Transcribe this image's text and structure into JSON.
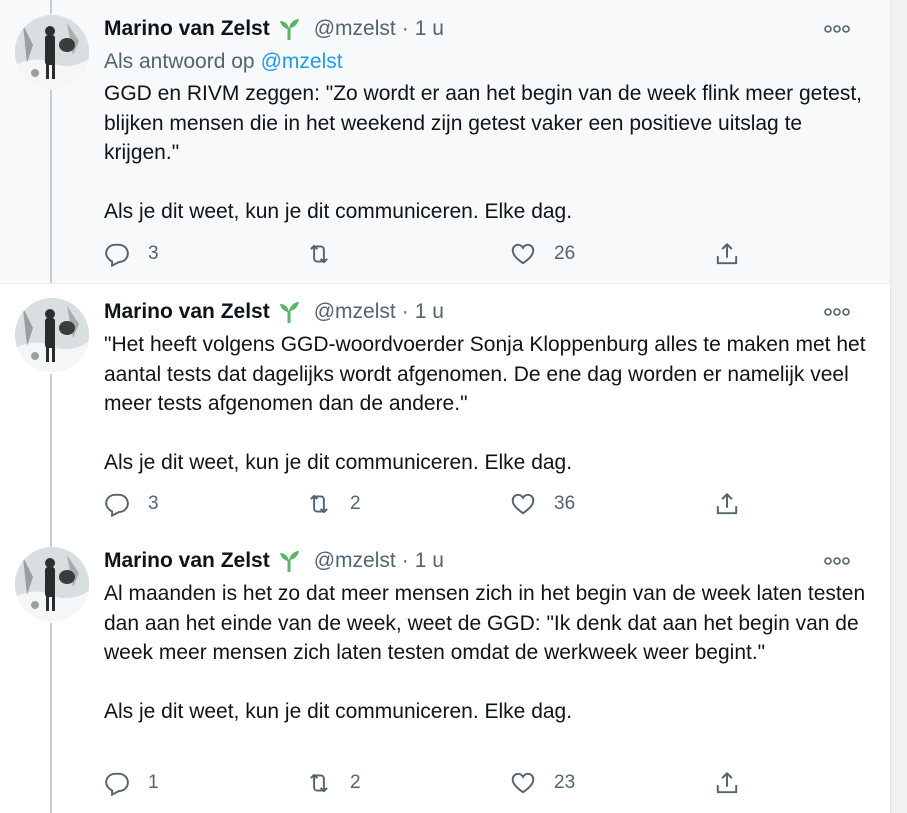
{
  "tweets": [
    {
      "author_name": "Marino van Zelst",
      "handle": "@mzelst",
      "dot": "·",
      "time": "1 u",
      "reply_prefix": "Als antwoord op",
      "reply_mention": "@mzelst",
      "paragraphs": [
        "GGD en RIVM zeggen: \"Zo wordt er aan het begin van de week flink meer getest, blijken mensen die in het weekend zijn getest vaker een positieve uitslag te krijgen.\"",
        "Als je dit weet, kun je dit communiceren. Elke dag."
      ],
      "replies": "3",
      "retweets": "",
      "likes": "26"
    },
    {
      "author_name": "Marino van Zelst",
      "handle": "@mzelst",
      "dot": "·",
      "time": "1 u",
      "paragraphs": [
        "\"Het heeft volgens GGD-woordvoerder Sonja Kloppenburg alles te maken met het aantal tests dat dagelijks wordt afgenomen. De ene dag worden er namelijk veel meer tests afgenomen dan de andere.\"",
        "Als je dit weet, kun je dit communiceren. Elke dag."
      ],
      "replies": "3",
      "retweets": "2",
      "likes": "36"
    },
    {
      "author_name": "Marino van Zelst",
      "handle": "@mzelst",
      "dot": "·",
      "time": "1 u",
      "paragraphs": [
        "Al maanden is het zo dat meer mensen zich in het begin van de week laten testen dan aan het einde van de week, weet de GGD: \"Ik denk dat aan het begin van de week meer mensen zich laten testen omdat de werkweek weer begint.\"",
        "Als je dit weet, kun je dit communiceren. Elke dag."
      ],
      "replies": "1",
      "retweets": "2",
      "likes": "23"
    }
  ],
  "icons": {
    "verified_badge": "seedling-icon",
    "more": "more-dots-icon",
    "reply": "reply-icon",
    "retweet": "retweet-icon",
    "like": "heart-icon",
    "share": "share-icon"
  },
  "colors": {
    "text": "#0f1419",
    "muted": "#536471",
    "link": "#1d9bf0",
    "sprout": "#5ab46a",
    "highlight_bg": "#f7f9fa"
  }
}
